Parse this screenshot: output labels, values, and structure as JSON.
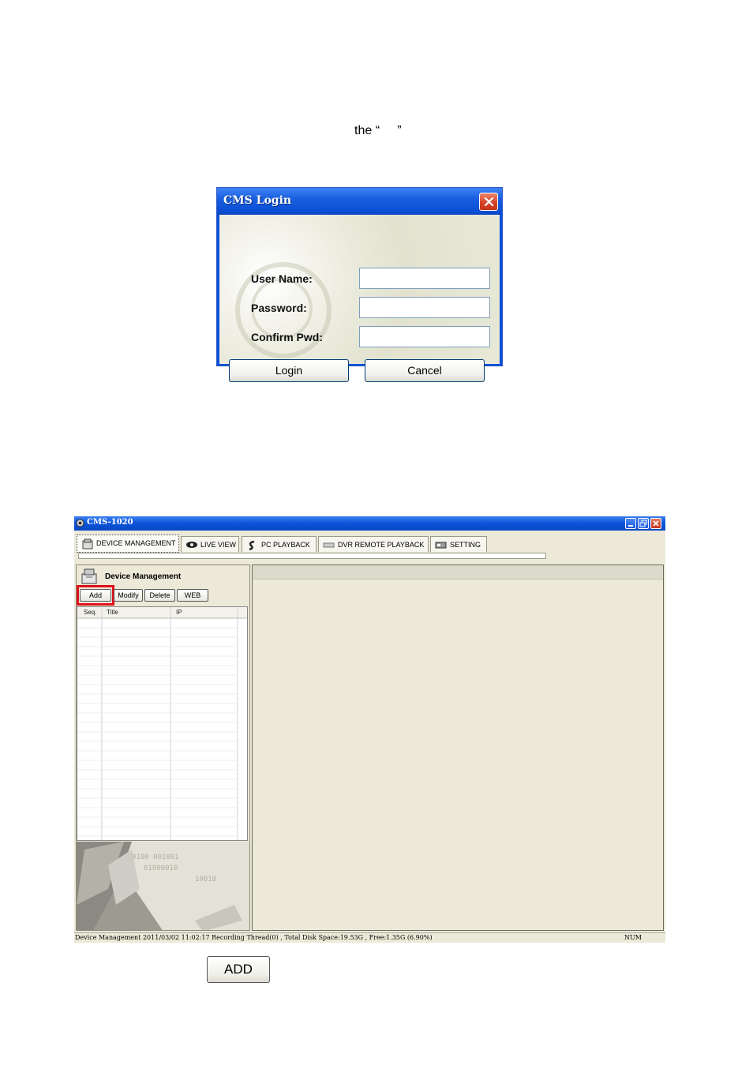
{
  "intro_text": "the “     ”",
  "login": {
    "title": "CMS Login",
    "username_label": "User Name:",
    "password_label": "Password:",
    "confirm_label": "Confirm Pwd:",
    "login_button": "Login",
    "cancel_button": "Cancel"
  },
  "app": {
    "title": "CMS-1020",
    "tabs": [
      {
        "label": "DEVICE MANAGEMENT",
        "icon": "device-management-icon"
      },
      {
        "label": "LIVE VIEW",
        "icon": "eye-icon"
      },
      {
        "label": "PC PLAYBACK",
        "icon": "playback-icon"
      },
      {
        "label": "DVR REMOTE PLAYBACK",
        "icon": "remote-playback-icon"
      },
      {
        "label": "SETTING",
        "icon": "setting-icon"
      }
    ],
    "panel_title": "Device Management",
    "buttons": {
      "add": "Add",
      "modify": "Modify",
      "delete": "Delete",
      "web": "WEB"
    },
    "columns": [
      "Seq.",
      "Title",
      "IP"
    ],
    "status_text": "Device Management  2011/03/02 11:02:17   Recording Thread(0) , Total Disk Space:19.53G , Free:1.35G (6.90%)",
    "status_num": "NUM"
  },
  "add_button_label": "ADD",
  "colors": {
    "highlight": "#e0101a",
    "titlebar": "#0b54d8",
    "window_bg": "#ece9d8"
  }
}
